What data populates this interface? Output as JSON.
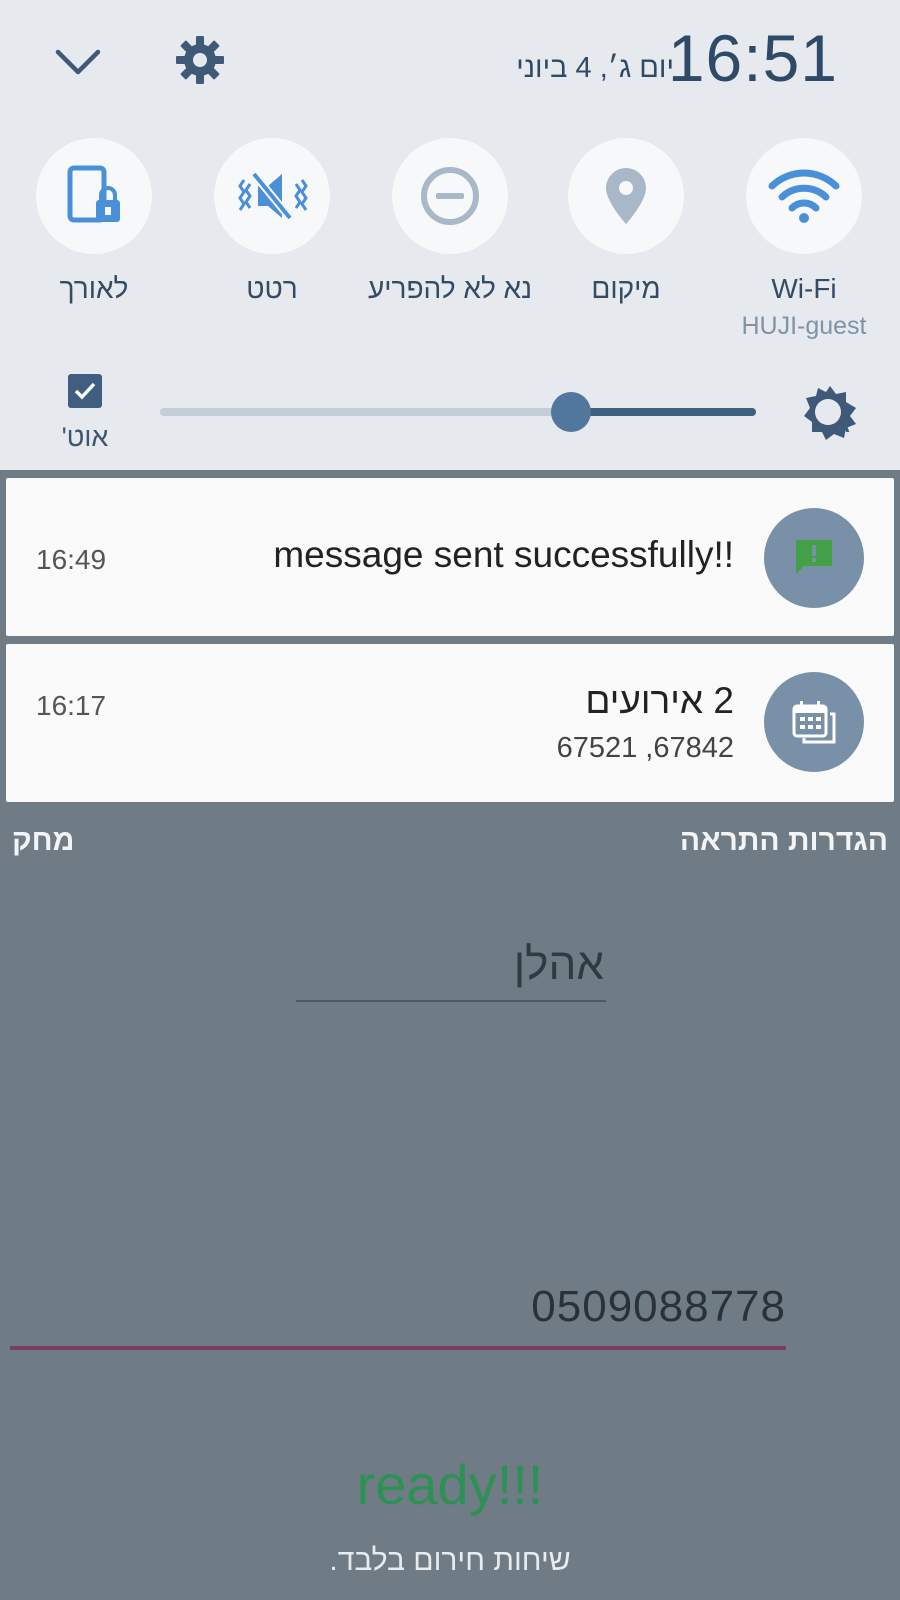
{
  "header": {
    "time": "16:51",
    "date": "יום ג׳, 4 ביוני",
    "expand_icon": "chevron-down-icon",
    "settings_icon": "gear-icon"
  },
  "quick_toggles": [
    {
      "label": "Wi-Fi",
      "sublabel": "HUJI-guest",
      "icon": "wifi-icon",
      "active": true
    },
    {
      "label": "מיקום",
      "icon": "location-pin-icon",
      "active": false
    },
    {
      "label": "נא לא להפריע",
      "icon": "do-not-disturb-icon",
      "active": false
    },
    {
      "label": "רטט",
      "icon": "vibrate-icon",
      "active": true
    },
    {
      "label": "לאורך",
      "icon": "portrait-lock-icon",
      "active": true
    }
  ],
  "brightness": {
    "auto_label": "אוט'",
    "auto_checked": true,
    "level": 0.31,
    "icon": "brightness-auto-icon"
  },
  "notifications": [
    {
      "title": "message sent successfully!!",
      "time": "16:49",
      "icon": "message-alert-icon",
      "icon_color": "#43a047"
    },
    {
      "title": "2 אירועים",
      "subtitle": "67842, 67521",
      "time": "16:17",
      "icon": "calendar-icon"
    }
  ],
  "notification_actions": {
    "settings_label": "הגדרות התראה",
    "clear_label": "מחק"
  },
  "app": {
    "greeting_value": "אהלן",
    "phone_value": "0509088778",
    "status_text": "ready!!!",
    "emergency_text": "שיחות חירום בלבד."
  },
  "colors": {
    "accent": "#4a90d9",
    "shade_bg": "#e6eaef",
    "dim_bg": "#6f7c86",
    "status_green": "#2e9154"
  }
}
